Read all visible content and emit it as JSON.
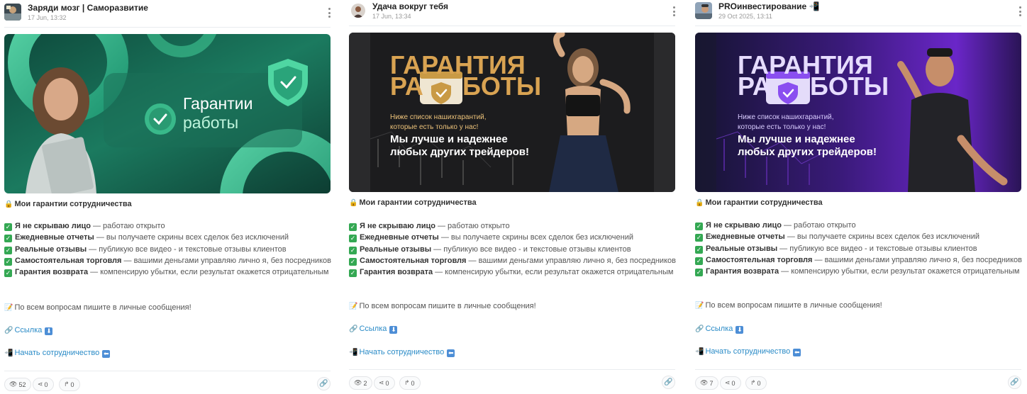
{
  "posts": [
    {
      "channel": "Заряди мозг | Саморазвитие",
      "date": "17 Jun, 13:32",
      "title": "Мои гарантии сотрудничества",
      "items": [
        {
          "bold": "Я не скрываю лицо",
          "rest": " — работаю открыто"
        },
        {
          "bold": "Ежедневные отчеты",
          "rest": " — вы получаете скрины всех сделок без исключений"
        },
        {
          "bold": "Реальные отзывы",
          "rest": " — публикую все видео - и текстовые отзывы клиентов"
        },
        {
          "bold": "Самостоятельная торговля",
          "rest": " — вашими деньгами управляю лично я, без посредников"
        },
        {
          "bold": "Гарантия возврата",
          "rest": " — компенсирую убытки, если результат окажется отрицательным"
        }
      ],
      "contact": "По всем вопросам пишите в личные сообщения!",
      "link_label": "Ссылка",
      "start_label": "Начать сотрудничество",
      "image": {
        "heading1": "Гарантии",
        "heading2": "работы"
      },
      "views": "52",
      "shares": "0",
      "forwards": "0"
    },
    {
      "channel": "Удача вокруг тебя",
      "date": "17 Jun, 13:34",
      "title": "Мои гарантии сотрудничества",
      "items": [
        {
          "bold": "Я не скрываю лицо",
          "rest": " — работаю открыто"
        },
        {
          "bold": "Ежедневные отчеты",
          "rest": " — вы получаете скрины всех сделок без исключений"
        },
        {
          "bold": "Реальные отзывы",
          "rest": " — публикую все видео - и текстовые отзывы клиентов"
        },
        {
          "bold": "Самостоятельная торговля",
          "rest": " — вашими деньгами управляю лично я, без посредников"
        },
        {
          "bold": "Гарантия возврата",
          "rest": " — компенсирую убытки, если результат окажется отрицательным"
        }
      ],
      "contact": "По всем вопросам пишите в личные сообщения!",
      "link_label": "Ссылка",
      "start_label": "Начать сотрудничество",
      "image": {
        "heading1": "ГАРАНТИЯ",
        "heading2a": "РА",
        "heading2b": "БОТЫ",
        "sub1": "Ниже список нашихгарантий,",
        "sub2": "которые есть только у нас!",
        "big1": "Мы лучше и надежнее",
        "big2": "любых других трейдеров!"
      },
      "views": "2",
      "shares": "0",
      "forwards": "0"
    },
    {
      "channel": "PROинвестирование",
      "date": "29 Oct 2025, 13:11",
      "title": "Мои гарантии сотрудничества",
      "items": [
        {
          "bold": "Я не скрываю лицо",
          "rest": " — работаю открыто"
        },
        {
          "bold": "Ежедневные отчеты",
          "rest": " — вы получаете скрины всех сделок без исключений"
        },
        {
          "bold": "Реальные отзывы",
          "rest": " — публикую все видео - и текстовые отзывы клиентов"
        },
        {
          "bold": "Самостоятельная торговля",
          "rest": " — вашими деньгами управляю лично я, без посредников"
        },
        {
          "bold": "Гарантия возврата",
          "rest": " — компенсирую убытки, если результат окажется отрицательным"
        }
      ],
      "contact": "По всем вопросам пишите в личные сообщения!",
      "link_label": "Ссылка",
      "start_label": "Начать сотрудничество",
      "image": {
        "heading1": "ГАРАНТИЯ",
        "heading2a": "РА",
        "heading2b": "БОТЫ",
        "sub1": "Ниже список нашихгарантий,",
        "sub2": "которые есть только у нас!",
        "big1": "Мы лучше и надежнее",
        "big2": "любых других трейдеров!"
      },
      "views": "7",
      "shares": "0",
      "forwards": "0"
    }
  ],
  "icons": {
    "title": "lock-icon",
    "check": "check-icon",
    "contact": "memo-icon",
    "link": "chain-link-icon",
    "start": "mobile-arrow-icon",
    "views": "eye-icon",
    "shares": "share-icon",
    "forwards": "forward-icon",
    "copy_link": "link-icon",
    "more": "more-vertical-icon"
  },
  "colors": {
    "link": "#2a8bc7",
    "check": "#34a853",
    "arrow_badge": "#4d8ed6"
  }
}
